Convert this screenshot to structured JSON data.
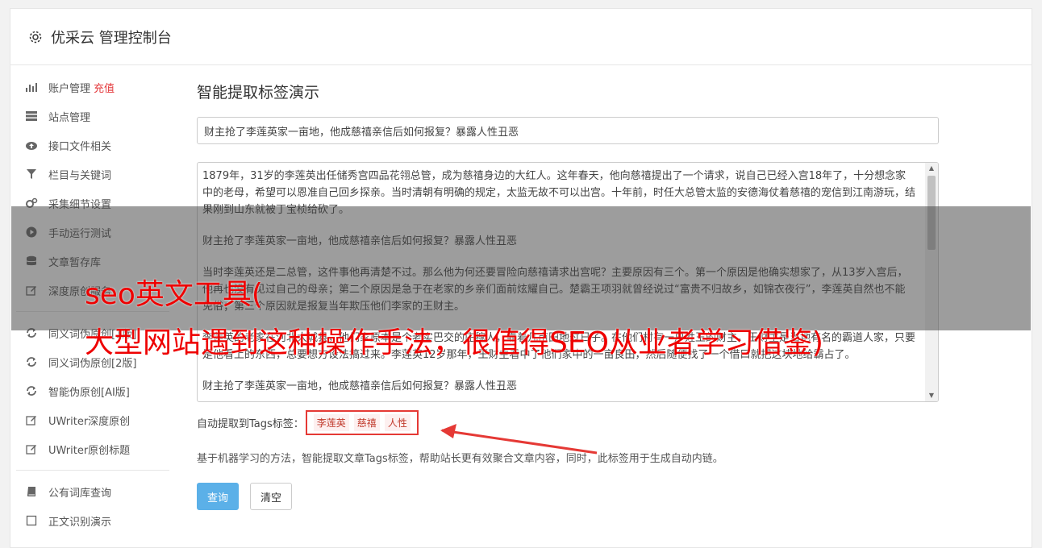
{
  "header": {
    "title": "优采云 管理控制台",
    "icon": "gear-icon"
  },
  "sidebar": {
    "items": [
      {
        "label": "账户管理",
        "badge": "充值",
        "icon": "bar-chart-icon"
      },
      {
        "label": "站点管理",
        "icon": "server-icon"
      },
      {
        "label": "接口文件相关",
        "icon": "cloud-upload-icon"
      },
      {
        "label": "栏目与关键词",
        "icon": "filter-icon"
      },
      {
        "label": "采集细节设置",
        "icon": "cogs-icon"
      },
      {
        "label": "手动运行测试",
        "icon": "play-circle-icon"
      },
      {
        "label": "文章暂存库",
        "icon": "database-icon"
      },
      {
        "label": "深度原创服务",
        "icon": "edit-icon"
      }
    ],
    "items2": [
      {
        "label": "同义词伪原创[1版]",
        "icon": "refresh-icon"
      },
      {
        "label": "同义词伪原创[2版]",
        "icon": "refresh-icon"
      },
      {
        "label": "智能伪原创[AI版]",
        "icon": "refresh-icon"
      },
      {
        "label": "UWriter深度原创",
        "icon": "edit-icon"
      },
      {
        "label": "UWriter原创标题",
        "icon": "edit-icon"
      }
    ],
    "items3": [
      {
        "label": "公有词库查询",
        "icon": "book-icon"
      },
      {
        "label": "正文识别演示",
        "icon": "square-icon"
      }
    ]
  },
  "main": {
    "heading": "智能提取标签演示",
    "title_value": "财主抢了李莲英家一亩地，他成慈禧亲信后如何报复？暴露人性丑恶",
    "paragraphs": [
      "1879年，31岁的李莲英出任储秀宫四品花翎总管，成为慈禧身边的大红人。这年春天，他向慈禧提出了一个请求，说自己已经入宫18年了，十分想念家中的老母，希望可以恩准自己回乡探亲。当时清朝有明确的规定，太监无故不可以出宫。十年前，时任大总管太监的安德海仗着慈禧的宠信到江南游玩，结果刚到山东就被丁宝桢给砍了。",
      "财主抢了李莲英家一亩地，他成慈禧亲信后如何报复？暴露人性丑恶",
      "当时李莲英还是二总管，这件事他再清楚不过。那么他为何还要冒险向慈禧请求出宫呢？主要原因有三个。第一个原因是他确实想家了，从13岁入宫后，他再也没有见过自己的母亲；第二个原因是急于在老家的乡亲们面前炫耀自己。楚霸王项羽就曾经说过“富贵不归故乡，如锦衣夜行”，李莲英自然也不能免俗；第三个原因就是报复当年欺压他们李家的王财主。",
      "李莲英的老家在河北大城县，他们家原本是个老实巴交的庄稼人，靠着几亩田地过日子。在他们村有一户姓王的财主，王财主是当地有名的霸道人家，只要是他看上的东西，总要想方设法搞过来。李莲英12岁那年，王财主看中了他们家中的一亩良田，然后随便找了一个借口就把这块地给霸占了。",
      "财主抢了李莲英家一亩地，他成慈禧亲信后如何报复？暴露人性丑恶"
    ],
    "tags_label": "自动提取到Tags标签：",
    "tags": [
      "李莲英",
      "慈禧",
      "人性"
    ],
    "description": "基于机器学习的方法，智能提取文章Tags标签，帮助站长更有效聚合文章内容，同时，此标签用于生成自动内链。",
    "query_button": "查询",
    "clear_button": "清空"
  },
  "overlay": {
    "line1": "seo英文工具(",
    "line2": "大型网站遇到这种操作手法，很值得SEO从业者学习借鉴)"
  },
  "colors": {
    "accent": "#5bb0e8",
    "badge": "#e4393c",
    "overlay_text": "#e00000",
    "arrow": "#e53935"
  }
}
